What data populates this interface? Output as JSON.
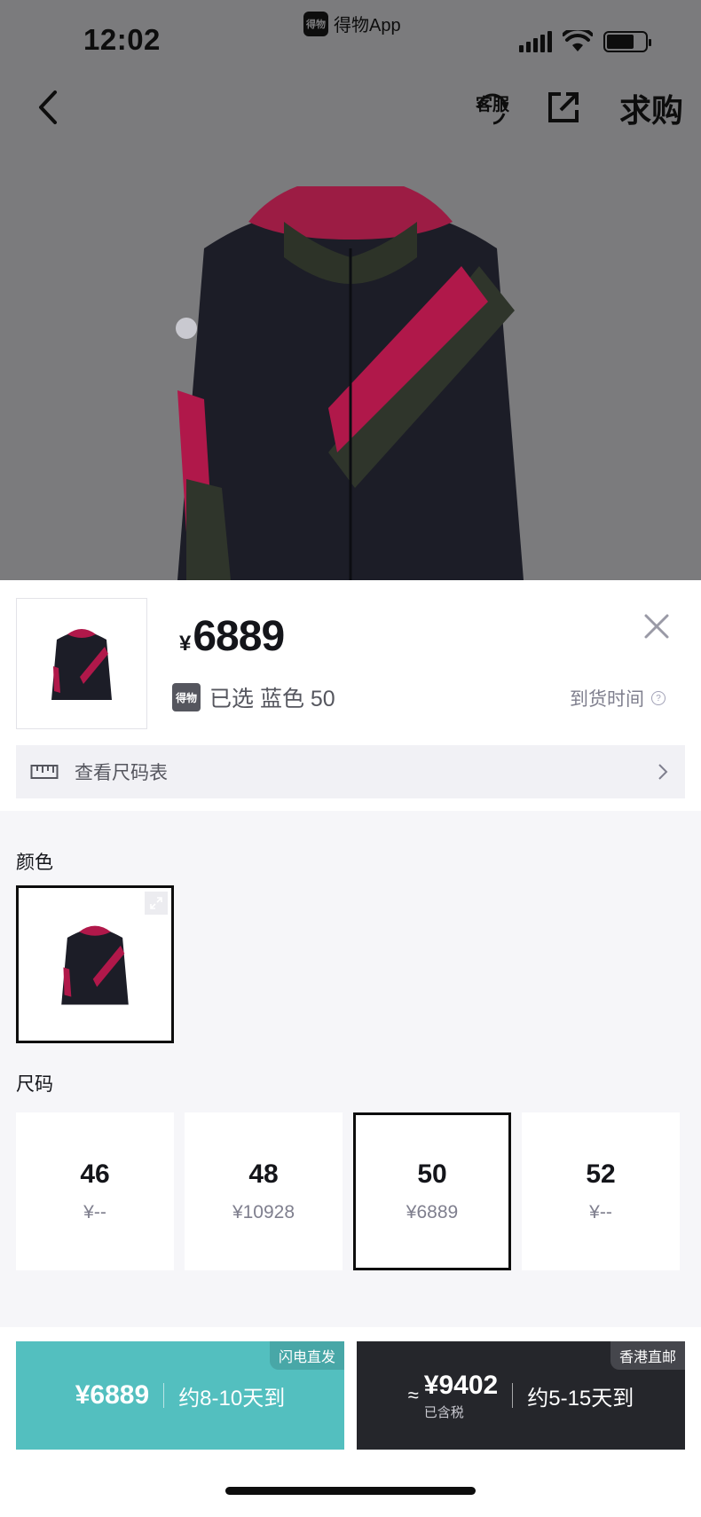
{
  "status_bar": {
    "time": "12:02",
    "app_name": "得物App",
    "app_logo_text": "得物"
  },
  "nav": {
    "service_label": "客服",
    "wish_label": "求购"
  },
  "product": {
    "currency": "¥",
    "price": "6889",
    "badge": "得物",
    "selected_text": "已选 蓝色 50",
    "arrival_label": "到货时间",
    "help_symbol": "?"
  },
  "size_chart": {
    "label": "查看尺码表"
  },
  "color_section": {
    "label": "颜色"
  },
  "size_section": {
    "label": "尺码",
    "items": [
      {
        "size": "46",
        "price": "¥--"
      },
      {
        "size": "48",
        "price": "¥10928"
      },
      {
        "size": "50",
        "price": "¥6889",
        "selected": true
      },
      {
        "size": "52",
        "price": "¥--"
      }
    ]
  },
  "buy_options": {
    "flash": {
      "tag": "闪电直发",
      "price": "¥6889",
      "eta": "约8-10天到",
      "color": "#53bfbf"
    },
    "hk": {
      "tag": "香港直邮",
      "approx": "≈",
      "price": "¥9402",
      "tax": "已含税",
      "eta": "约5-15天到",
      "color": "#25262b"
    }
  }
}
